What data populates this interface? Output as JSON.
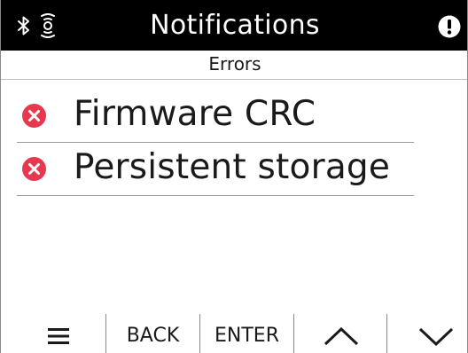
{
  "header": {
    "title": "Notifications",
    "icons": [
      "bluetooth-icon",
      "sensor-icon",
      "alert-icon"
    ]
  },
  "subheader": {
    "label": "Errors"
  },
  "notifications": [
    {
      "label": "Firmware CRC",
      "icon": "error-icon"
    },
    {
      "label": "Persistent storage",
      "icon": "error-icon"
    }
  ],
  "toolbar": {
    "menu_icon": "menu-icon",
    "back_label": "BACK",
    "enter_label": "ENTER",
    "up_icon": "chevron-up-icon",
    "down_icon": "chevron-down-icon"
  },
  "colors": {
    "titlebar_bg": "#000000",
    "titlebar_fg": "#ffffff",
    "error": "#e8384f"
  }
}
